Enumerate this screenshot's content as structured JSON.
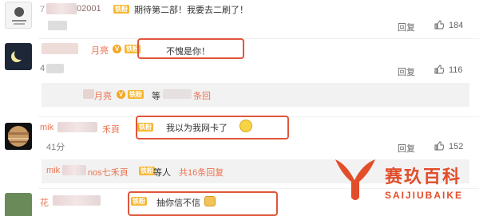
{
  "comments": [
    {
      "name_fragment": "7",
      "name_suffix": "02001",
      "text": "期待第二部！我要去二刷了！",
      "reply_label": "回复",
      "likes": "184"
    },
    {
      "name_suffix": "月亮",
      "text": "不愧是你！",
      "time_fragment": "4",
      "reply_label": "回复",
      "likes": "116",
      "sub_reply": {
        "name_suffix": "月亮",
        "text_fragment": "等",
        "more_fragment": "条回"
      }
    },
    {
      "name_prefix": "mik",
      "name_suffix": "禾頁",
      "text": "我以为我网卡了",
      "time_fragment": "41分",
      "reply_label": "回复",
      "likes": "152",
      "sub_reply": {
        "name_prefix": "mik",
        "name_suffix": "nos七禾頁",
        "text": "等人",
        "more": "共16条回复"
      }
    },
    {
      "name_prefix": "花",
      "text": "抽你信不信"
    }
  ],
  "watermark": {
    "title": "赛玖百科",
    "subtitle": "SAIJIUBAIKE"
  },
  "colors": {
    "highlight": "#e0563b",
    "username": "#eb7350",
    "brand": "#e24d2a"
  },
  "fan_badge": "铁粉"
}
